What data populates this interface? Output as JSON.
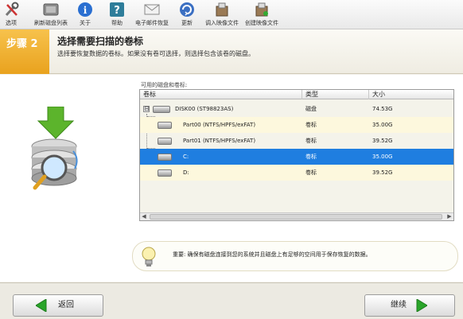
{
  "toolbar": {
    "items": [
      {
        "label": "选项",
        "icon": "tools-icon"
      },
      {
        "label": "刷新磁盘列表",
        "icon": "drive-refresh-icon"
      },
      {
        "label": "关于",
        "icon": "info-icon"
      },
      {
        "label": "帮助",
        "icon": "help-icon"
      },
      {
        "label": "电子邮件恢复",
        "icon": "email-icon"
      },
      {
        "label": "更新",
        "icon": "update-icon"
      },
      {
        "label": "调入映像文件",
        "icon": "load-image-icon"
      },
      {
        "label": "创建映像文件",
        "icon": "create-image-icon"
      }
    ]
  },
  "step": {
    "label": "步骤 2",
    "title": "选择需要扫描的卷标",
    "description": "选择要恢复数据的卷标。如果没有卷可选择，则选择包含该卷的磁盘。"
  },
  "volumes": {
    "caption": "可用的磁盘和卷标:",
    "columns": [
      "卷标",
      "类型",
      "大小"
    ],
    "rows": [
      {
        "name": "DISK00 (ST98823AS)",
        "type": "磁盘",
        "size": "74.53G"
      },
      {
        "name": "Part00 (NTFS/HPFS/exFAT)",
        "type": "卷标",
        "size": "35.00G"
      },
      {
        "name": "Part01 (NTFS/HPFS/exFAT)",
        "type": "卷标",
        "size": "39.52G"
      },
      {
        "name": "C:",
        "type": "卷标",
        "size": "35.00G"
      },
      {
        "name": "D:",
        "type": "卷标",
        "size": "39.52G"
      }
    ],
    "expander": "⊟"
  },
  "notice": {
    "text": "重要: 确保有磁盘连接到您的系统并且磁盘上有足够的空间用于保存恢复的数据。"
  },
  "footer": {
    "back_label": "返回",
    "next_label": "继续"
  },
  "colors": {
    "accent_orange": "#f2b33a",
    "selection_blue": "#1f7ee0",
    "alt_row": "#fdf8dd",
    "arrow_green": "#2aa52a"
  }
}
